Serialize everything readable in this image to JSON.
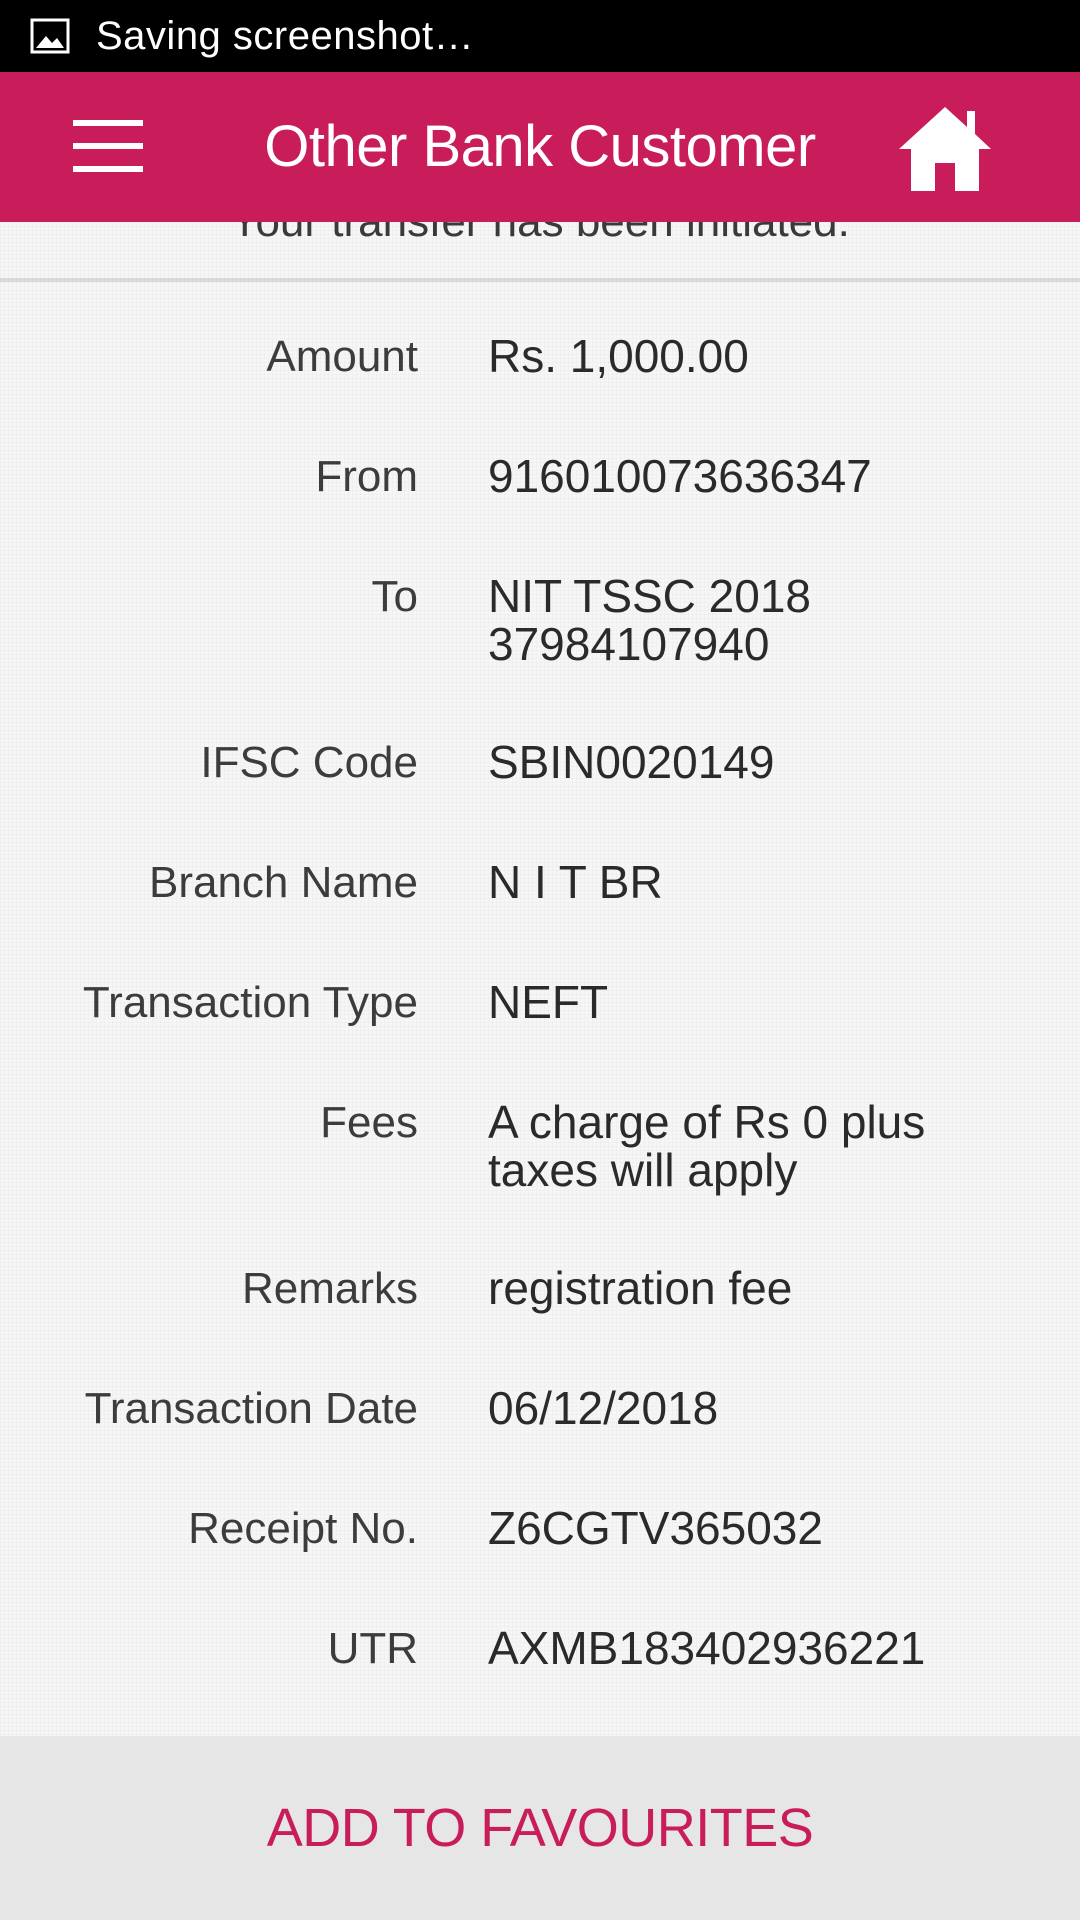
{
  "status_bar": {
    "icon": "image-icon",
    "text": "Saving screenshot…"
  },
  "app_bar": {
    "title": "Other Bank Customer",
    "menu_icon": "hamburger-menu-icon",
    "home_icon": "home-icon",
    "background": "#c81c5b"
  },
  "header_message": "Your transfer has been initiated.",
  "details": [
    {
      "label": "Amount",
      "value": "Rs. 1,000.00"
    },
    {
      "label": "From",
      "value": "916010073636347"
    },
    {
      "label": "To",
      "value": "NIT TSSC 2018\n37984107940"
    },
    {
      "label": "IFSC Code",
      "value": "SBIN0020149"
    },
    {
      "label": "Branch Name",
      "value": "N I T BR"
    },
    {
      "label": "Transaction Type",
      "value": "NEFT"
    },
    {
      "label": "Fees",
      "value": "A charge of Rs 0 plus\ntaxes will apply"
    },
    {
      "label": "Remarks",
      "value": "registration fee"
    },
    {
      "label": "Transaction Date",
      "value": "06/12/2018"
    },
    {
      "label": "Receipt No.",
      "value": "Z6CGTV365032"
    },
    {
      "label": "UTR",
      "value": "AXMB183402936221"
    }
  ],
  "bottom_bar": {
    "button_label": "ADD TO FAVOURITES",
    "accent": "#c81c5b"
  }
}
